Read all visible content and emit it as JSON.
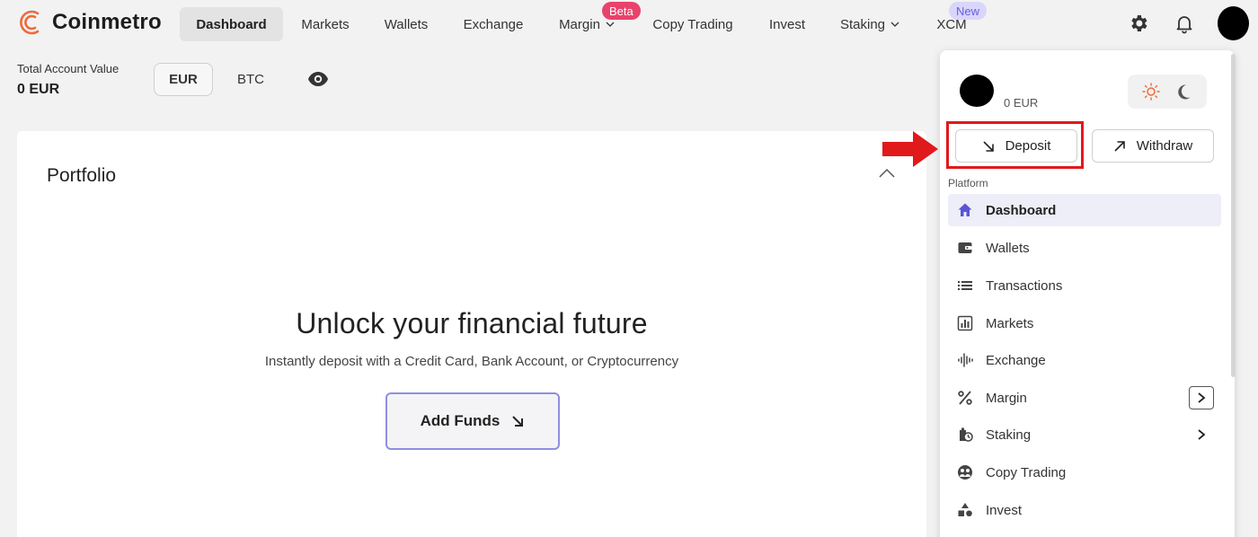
{
  "brand": {
    "name": "Coinmetro",
    "accent": "#ef6a3b"
  },
  "nav": {
    "items": [
      {
        "label": "Dashboard",
        "active": true
      },
      {
        "label": "Markets"
      },
      {
        "label": "Wallets"
      },
      {
        "label": "Exchange"
      },
      {
        "label": "Margin",
        "has_dropdown": true,
        "badge": "Beta"
      },
      {
        "label": "Copy Trading"
      },
      {
        "label": "Invest"
      },
      {
        "label": "Staking",
        "has_dropdown": true
      },
      {
        "label": "XCM",
        "badge": "New"
      }
    ],
    "icons": [
      "gear-icon",
      "bell-icon",
      "avatar"
    ]
  },
  "account": {
    "label": "Total Account Value",
    "value": "0 EUR",
    "currencies": [
      "EUR",
      "BTC"
    ],
    "selected_currency": "EUR"
  },
  "portfolio": {
    "title": "Portfolio",
    "headline": "Unlock your financial future",
    "subtext": "Instantly deposit with a Credit Card, Bank Account, or Cryptocurrency",
    "cta": "Add Funds"
  },
  "user_menu": {
    "balance": "0 EUR",
    "deposit_label": "Deposit",
    "withdraw_label": "Withdraw",
    "section_label": "Platform",
    "items": [
      {
        "label": "Dashboard",
        "icon": "home-icon",
        "active": true
      },
      {
        "label": "Wallets",
        "icon": "wallet-icon"
      },
      {
        "label": "Transactions",
        "icon": "list-icon"
      },
      {
        "label": "Markets",
        "icon": "bar-chart-icon"
      },
      {
        "label": "Exchange",
        "icon": "waveform-icon"
      },
      {
        "label": "Margin",
        "icon": "percent-icon",
        "submenu": "boxed"
      },
      {
        "label": "Staking",
        "icon": "staking-icon",
        "submenu": "plain"
      },
      {
        "label": "Copy Trading",
        "icon": "copy-trading-icon"
      },
      {
        "label": "Invest",
        "icon": "shapes-icon"
      }
    ]
  },
  "colors": {
    "annotation_red": "#e0191b",
    "active_menu_icon": "#5b54d6",
    "beta_badge": "#e8436b",
    "new_badge_bg": "#d9d6fb"
  }
}
